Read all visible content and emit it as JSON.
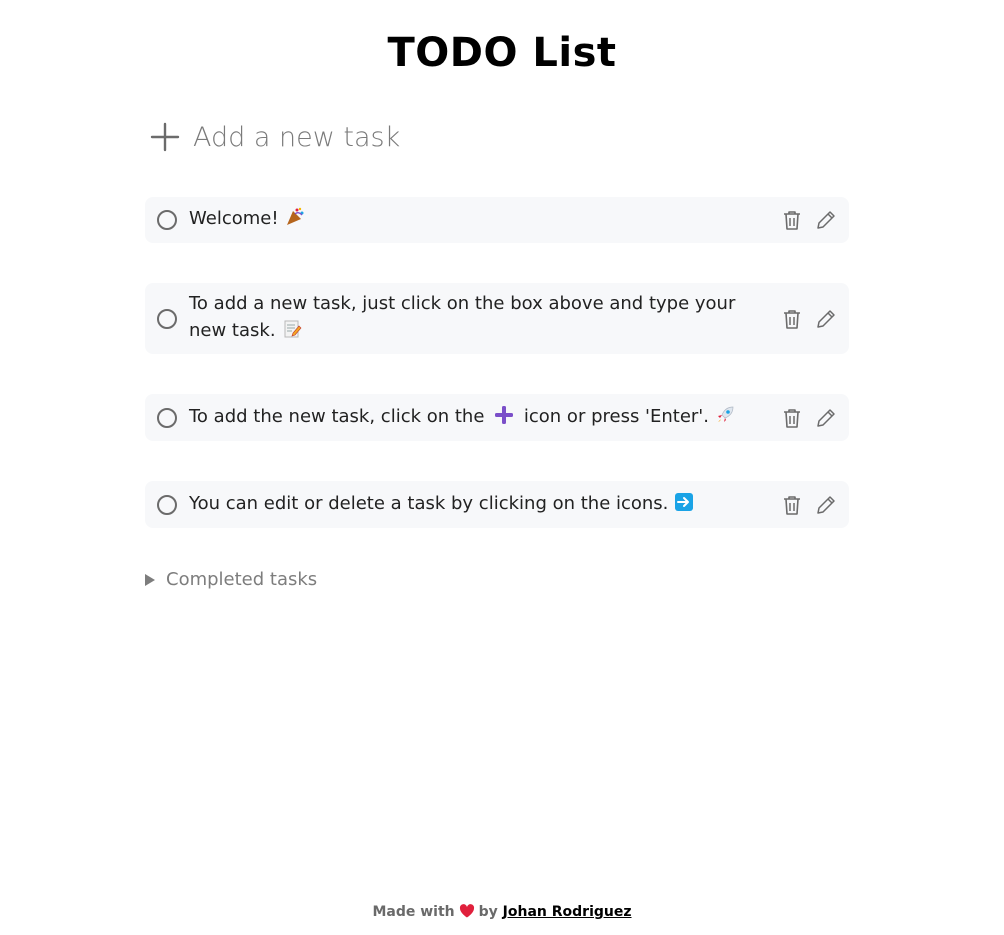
{
  "app": {
    "title": "TODO List"
  },
  "add_task": {
    "placeholder": "Add a new task"
  },
  "tasks": [
    {
      "text": "Welcome!",
      "emoji": "party-popper"
    },
    {
      "text": "To add a new task, just click on the box above and type your new task.",
      "emoji": "memo"
    },
    {
      "text_before": "To add the new task, click on the",
      "inline_emoji": "plus",
      "text_after": "icon or press 'Enter'.",
      "emoji": "rocket"
    },
    {
      "text": "You can edit or delete a task by clicking on the icons.",
      "emoji": "right-arrow"
    }
  ],
  "completed": {
    "label": "Completed tasks"
  },
  "footer": {
    "made_with": "Made with",
    "by": "by",
    "author": "Johan Rodriguez"
  },
  "colors": {
    "task_bg": "#f7f8fa",
    "icon": "#6b6b6b",
    "heart": "#e0203c",
    "plus_accent": "#7b4fc9",
    "arrow_blue": "#1aa3e6"
  }
}
